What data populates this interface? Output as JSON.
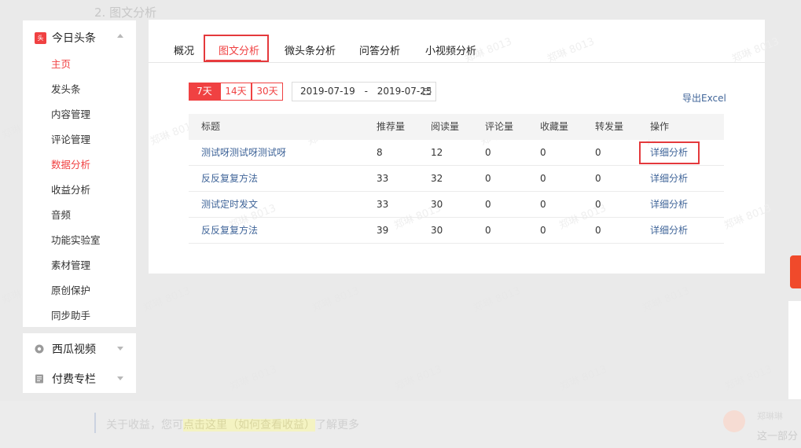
{
  "doc_heading": "2. 图文分析",
  "sidebar": {
    "app_logo": "头条",
    "app_name": "今日头条",
    "items": [
      {
        "label": "主页"
      },
      {
        "label": "发头条"
      },
      {
        "label": "内容管理"
      },
      {
        "label": "评论管理"
      },
      {
        "label": "数据分析"
      },
      {
        "label": "收益分析"
      },
      {
        "label": "音频"
      },
      {
        "label": "功能实验室"
      },
      {
        "label": "素材管理"
      },
      {
        "label": "原创保护"
      },
      {
        "label": "同步助手"
      }
    ],
    "sections": [
      {
        "label": "西瓜视频",
        "icon": "play-circle-icon"
      },
      {
        "label": "付费专栏",
        "icon": "document-icon"
      }
    ]
  },
  "tabs": [
    "概况",
    "图文分析",
    "微头条分析",
    "问答分析",
    "小视频分析"
  ],
  "active_tab": "图文分析",
  "ranges": [
    "7天",
    "14天",
    "30天"
  ],
  "active_range": "7天",
  "date_range": {
    "start": "2019-07-19",
    "separator": "-",
    "end": "2019-07-25"
  },
  "export_label": "导出Excel",
  "table": {
    "headers": [
      "标题",
      "推荐量",
      "阅读量",
      "评论量",
      "收藏量",
      "转发量",
      "操作"
    ],
    "rows": [
      {
        "title": "测试呀测试呀测试呀",
        "rec": "8",
        "read": "12",
        "comment": "0",
        "fav": "0",
        "share": "0",
        "action": "详细分析"
      },
      {
        "title": "反反复复方法",
        "rec": "33",
        "read": "32",
        "comment": "0",
        "fav": "0",
        "share": "0",
        "action": "详细分析"
      },
      {
        "title": "测试定时发文",
        "rec": "33",
        "read": "30",
        "comment": "0",
        "fav": "0",
        "share": "0",
        "action": "详细分析"
      },
      {
        "title": "反反复复方法",
        "rec": "39",
        "read": "30",
        "comment": "0",
        "fav": "0",
        "share": "0",
        "action": "详细分析"
      }
    ]
  },
  "bottom": {
    "prefix": "关于收益，您可",
    "highlight": "点击这里（如何查看收益）",
    "suffix": "了解更多",
    "side_name": "郑琳琳",
    "side_note": "这一部分"
  },
  "watermark": "郑琳 8013",
  "colors": {
    "accent": "#f04142",
    "link": "#406599"
  }
}
